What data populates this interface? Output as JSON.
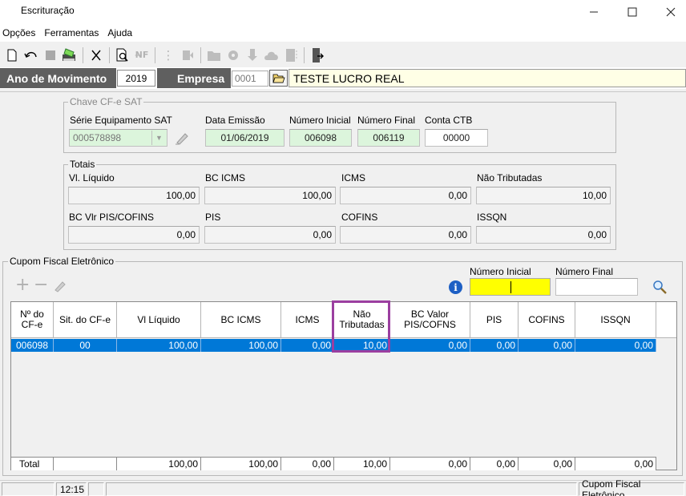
{
  "window": {
    "title": "Escrituração",
    "minimize": "—",
    "maximize": "☐",
    "close": "✕"
  },
  "menu": [
    "Opções",
    "Ferramentas",
    "Ajuda"
  ],
  "header": {
    "ano_label": "Ano de Movimento",
    "ano_value": "2019",
    "empresa_label": "Empresa",
    "empresa_code": "0001",
    "empresa_name": "TESTE LUCRO REAL"
  },
  "chave": {
    "legend": "Chave CF-e SAT",
    "serie_label": "Série Equipamento SAT",
    "serie_value": "000578898",
    "data_label": "Data Emissão",
    "data_value": "01/06/2019",
    "ninicial_label": "Número Inicial",
    "ninicial_value": "006098",
    "nfinal_label": "Número Final",
    "nfinal_value": "006119",
    "conta_label": "Conta CTB",
    "conta_value": "00000"
  },
  "totais": {
    "legend": "Totais",
    "fields": [
      {
        "label": "Vl. Líquido",
        "value": "100,00"
      },
      {
        "label": "BC ICMS",
        "value": "100,00"
      },
      {
        "label": "ICMS",
        "value": "0,00"
      },
      {
        "label": "Não Tributadas",
        "value": "10,00"
      },
      {
        "label": "BC Vlr PIS/COFINS",
        "value": "0,00"
      },
      {
        "label": "PIS",
        "value": "0,00"
      },
      {
        "label": "COFINS",
        "value": "0,00"
      },
      {
        "label": "ISSQN",
        "value": "0,00"
      }
    ]
  },
  "cupom": {
    "legend": "Cupom Fiscal Eletrônico",
    "ninicial_label": "Número Inicial",
    "ninicial_value": "",
    "nfinal_label": "Número Final",
    "nfinal_value": "",
    "add_icon": "+",
    "remove_icon": "−",
    "info_icon": "i"
  },
  "table": {
    "headers": [
      "Nº do\nCF-e",
      "Sit. do CF-e",
      "Vl Líquido",
      "BC ICMS",
      "ICMS",
      "Não\nTributadas",
      "BC Valor\nPIS/COFNS",
      "PIS",
      "COFINS",
      "ISSQN"
    ],
    "rows": [
      [
        "006098",
        "00",
        "100,00",
        "100,00",
        "0,00",
        "10,00",
        "0,00",
        "0,00",
        "0,00",
        "0,00"
      ]
    ],
    "total_label": "Total",
    "totals": [
      "",
      "100,00",
      "100,00",
      "0,00",
      "10,00",
      "0,00",
      "0,00",
      "0,00",
      "0,00"
    ],
    "highlight_color": "#9b3fa0",
    "selection_color": "#0078d7"
  },
  "statusbar": {
    "time": "12:15",
    "module": "Cupom Fiscal Eletrônico"
  }
}
